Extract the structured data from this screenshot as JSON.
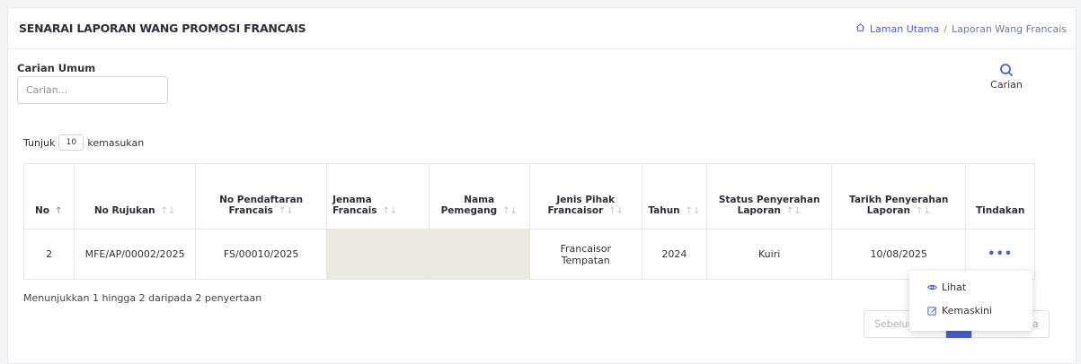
{
  "header": {
    "title": "SENARAI LAPORAN WANG PROMOSI FRANCAIS",
    "breadcrumb": {
      "home": "Laman Utama",
      "separator": "/",
      "current": "Laporan Wang Francais",
      "home_icon": "home-icon"
    }
  },
  "search": {
    "label": "Carian Umum",
    "placeholder": "Carian...",
    "value": "",
    "button_label": "Carian",
    "button_icon": "search-icon"
  },
  "length_control": {
    "prefix": "Tunjuk",
    "value": "10",
    "suffix": "kemasukan"
  },
  "table": {
    "columns": [
      {
        "label": "No",
        "sort": "↑"
      },
      {
        "label": "No Rujukan",
        "sort": "↑↓"
      },
      {
        "label": "No Pendaftaran Francais",
        "sort": "↑↓"
      },
      {
        "label": "Jenama Francais",
        "sort": "↑↓"
      },
      {
        "label": "Nama Pemegang",
        "sort": "↑↓"
      },
      {
        "label": "Jenis Pihak Francaisor",
        "sort": "↑↓"
      },
      {
        "label": "Tahun",
        "sort": "↑↓"
      },
      {
        "label": "Status Penyerahan Laporan",
        "sort": "↑↓"
      },
      {
        "label": "Tarikh Penyerahan Laporan",
        "sort": "↑↓"
      },
      {
        "label": "Tindakan",
        "sort": ""
      }
    ],
    "rows": [
      {
        "no": "2",
        "no_rujukan": "MFE/AP/00002/2025",
        "no_pendaftaran": "FS/00010/2025",
        "jenama": "",
        "nama_pemegang": "",
        "jenis_pihak": "Francaisor Tempatan",
        "tahun": "2024",
        "status": "Kuiri",
        "tarikh": "10/08/2025",
        "action": "•••"
      }
    ]
  },
  "info": "Menunjukkan 1 hingga 2 daripada 2 penyertaan",
  "pagination": {
    "prev": "Sebelumnya",
    "current": "1",
    "next": "Seterusnya"
  },
  "dropdown": {
    "items": [
      {
        "label": "Lihat",
        "icon": "eye-icon"
      },
      {
        "label": "Kemaskini",
        "icon": "edit-icon"
      }
    ]
  },
  "colors": {
    "accent": "#4a5fd1",
    "masked_cell": "#ece9e0"
  }
}
